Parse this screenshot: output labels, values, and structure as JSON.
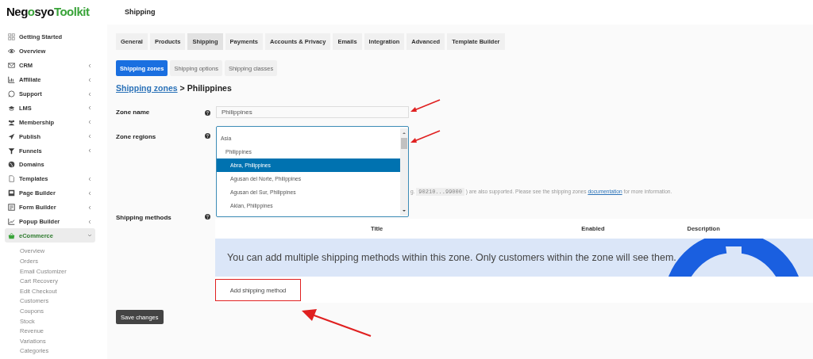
{
  "logo": {
    "part_1": "Neg",
    "part_2": "o",
    "part_3": "syo",
    "part_4": "Toolkit"
  },
  "sidebar": {
    "items": [
      {
        "label": "Getting Started",
        "has_submenu": false,
        "expanded": false,
        "selected": false
      },
      {
        "label": "Overview",
        "has_submenu": false,
        "expanded": false,
        "selected": false
      },
      {
        "label": "CRM",
        "has_submenu": true,
        "expanded": false,
        "selected": false
      },
      {
        "label": "Affiliate",
        "has_submenu": true,
        "expanded": false,
        "selected": false
      },
      {
        "label": "Support",
        "has_submenu": true,
        "expanded": false,
        "selected": false
      },
      {
        "label": "LMS",
        "has_submenu": true,
        "expanded": false,
        "selected": false
      },
      {
        "label": "Membership",
        "has_submenu": true,
        "expanded": false,
        "selected": false
      },
      {
        "label": "Publish",
        "has_submenu": true,
        "expanded": false,
        "selected": false
      },
      {
        "label": "Funnels",
        "has_submenu": true,
        "expanded": false,
        "selected": false
      },
      {
        "label": "Domains",
        "has_submenu": false,
        "expanded": false,
        "selected": false
      },
      {
        "label": "Templates",
        "has_submenu": true,
        "expanded": false,
        "selected": false
      },
      {
        "label": "Page Builder",
        "has_submenu": true,
        "expanded": false,
        "selected": false
      },
      {
        "label": "Form Builder",
        "has_submenu": true,
        "expanded": false,
        "selected": false
      },
      {
        "label": "Popup Builder",
        "has_submenu": true,
        "expanded": false,
        "selected": false
      },
      {
        "label": "eCommerce",
        "has_submenu": true,
        "expanded": true,
        "selected": true,
        "children": [
          "Overview",
          "Orders",
          "Email Customizer",
          "Cart Recovery",
          "Edit Checkout",
          "Customers",
          "Coupons",
          "Stock",
          "Revenue",
          "Variations",
          "Categories"
        ]
      }
    ]
  },
  "header": {
    "title": "Shipping"
  },
  "tabs": [
    {
      "label": "General",
      "selected": false
    },
    {
      "label": "Products",
      "selected": false
    },
    {
      "label": "Shipping",
      "selected": true
    },
    {
      "label": "Payments",
      "selected": false
    },
    {
      "label": "Accounts & Privacy",
      "selected": false
    },
    {
      "label": "Emails",
      "selected": false
    },
    {
      "label": "Integration",
      "selected": false
    },
    {
      "label": "Advanced",
      "selected": false
    },
    {
      "label": "Template Builder",
      "selected": false
    }
  ],
  "subtabs": [
    {
      "label": "Shipping zones",
      "selected": true
    },
    {
      "label": "Shipping options",
      "selected": false
    },
    {
      "label": "Shipping classes",
      "selected": false
    }
  ],
  "breadcrumb": {
    "link": "Shipping zones",
    "separator": ">",
    "current": "Philippines"
  },
  "zone_name": {
    "label": "Zone name",
    "value": "Philippines"
  },
  "zone_regions": {
    "label": "Zone regions",
    "options": [
      {
        "label": "Asia",
        "selected": false,
        "children": [
          {
            "label": "Philippines",
            "selected": false,
            "children": [
              {
                "label": "Abra, Philippines",
                "selected": true
              },
              {
                "label": "Agusan del Norte, Philippines",
                "selected": false
              },
              {
                "label": "Agusan del Sur, Philippines",
                "selected": false
              },
              {
                "label": "Aklan, Philippines",
                "selected": false
              }
            ]
          }
        ]
      }
    ],
    "help_prefix": "g.",
    "help_code": "90210...99000",
    "help_middle": ") are also supported. Please see the shipping zones",
    "help_link": "documentation",
    "help_suffix": "for more information."
  },
  "shipping_methods": {
    "label": "Shipping methods",
    "columns": [
      "Title",
      "Enabled",
      "Description"
    ],
    "empty_message": "You can add multiple shipping methods within this zone. Only customers within the zone will see them.",
    "add_button": "Add shipping method"
  },
  "save_button": "Save changes"
}
